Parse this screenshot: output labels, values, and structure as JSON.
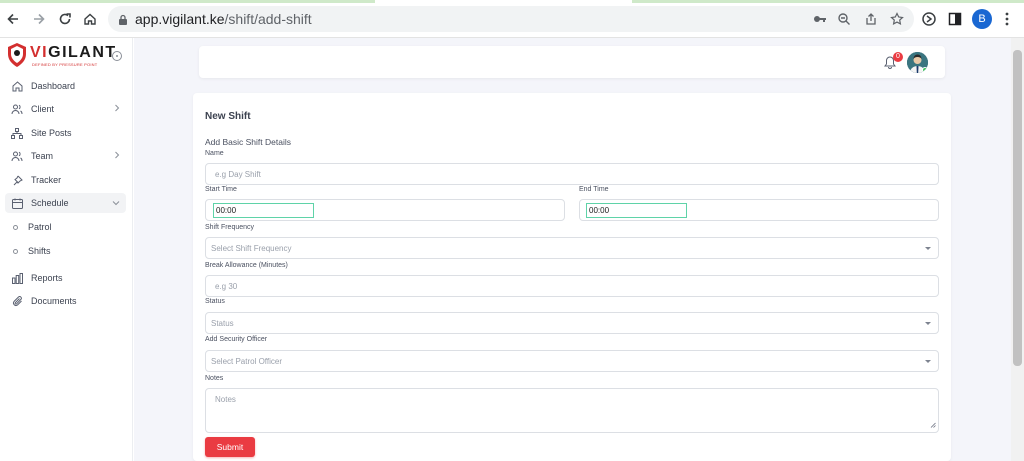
{
  "browser": {
    "url_host": "app.vigilant.ke",
    "url_path": "/shift/add-shift",
    "profile_initial": "B"
  },
  "sidebar": {
    "logo": {
      "brand_vi": "VI",
      "brand_rest": "GILANT",
      "tagline": "DEFINED BY PRESSURE POINT"
    },
    "items": [
      {
        "label": "Dashboard",
        "icon": "home-icon"
      },
      {
        "label": "Client",
        "icon": "users-icon",
        "expandable": true
      },
      {
        "label": "Site Posts",
        "icon": "sitemap-icon"
      },
      {
        "label": "Team",
        "icon": "users-icon",
        "expandable": true
      },
      {
        "label": "Tracker",
        "icon": "pin-icon"
      },
      {
        "label": "Schedule",
        "icon": "calendar-icon",
        "expanded": true
      },
      {
        "label": "Patrol",
        "icon": "dot-icon"
      },
      {
        "label": "Shifts",
        "icon": "dot-icon"
      },
      {
        "label": "Reports",
        "icon": "chart-icon"
      },
      {
        "label": "Documents",
        "icon": "paperclip-icon"
      }
    ]
  },
  "topbar": {
    "notification_count": "0"
  },
  "form": {
    "title": "New Shift",
    "section": "Add Basic Shift Details",
    "name_label": "Name",
    "name_placeholder": "e.g Day Shift",
    "start_label": "Start Time",
    "start_value": "00:00",
    "end_label": "End Time",
    "end_value": "00:00",
    "frequency_label": "Shift Frequency",
    "frequency_placeholder": "Select Shift Frequency",
    "break_label": "Break Allowance (Minutes)",
    "break_placeholder": "e.g 30",
    "status_label": "Status",
    "status_placeholder": "Status",
    "officer_label": "Add Security Officer",
    "officer_placeholder": "Select Patrol Officer",
    "notes_label": "Notes",
    "notes_placeholder": "Notes",
    "submit_label": "Submit"
  },
  "colors": {
    "accent": "#ea3b42",
    "time_focus": "#5fd3a8",
    "main_bg": "#f4f5fa"
  }
}
